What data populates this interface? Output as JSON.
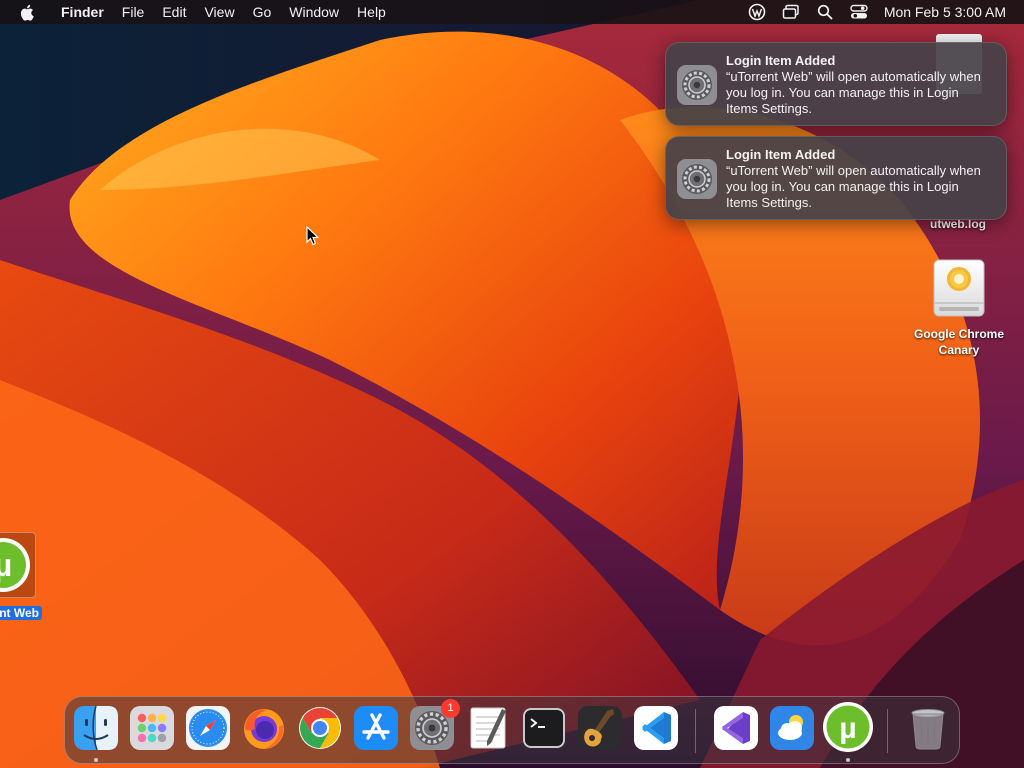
{
  "menubar": {
    "app_name": "Finder",
    "menus": [
      "File",
      "Edit",
      "View",
      "Go",
      "Window",
      "Help"
    ],
    "clock": "Mon Feb 5  3:00 AM"
  },
  "notifications": [
    {
      "title": "Login Item Added",
      "body": "“uTorrent Web” will open automatically when you log in. You can manage this in Login Items Settings.",
      "icon": "system-settings-icon"
    },
    {
      "title": "Login Item Added",
      "body": "“uTorrent Web” will open automatically when you log in. You can manage this in Login Items Settings.",
      "icon": "system-settings-icon"
    }
  ],
  "desktop": {
    "icons": [
      {
        "label": "utweb.log",
        "icon": "log-file-icon"
      },
      {
        "label": "Google Chrome Canary",
        "icon": "disk-image-icon"
      },
      {
        "label": "nt Web",
        "icon": "utorrent-icon",
        "selected": true
      }
    ]
  },
  "dock": {
    "items": [
      {
        "name": "Finder",
        "icon": "finder-icon",
        "running": true
      },
      {
        "name": "Launchpad",
        "icon": "launchpad-icon"
      },
      {
        "name": "Safari",
        "icon": "safari-icon"
      },
      {
        "name": "Firefox",
        "icon": "firefox-icon"
      },
      {
        "name": "Google Chrome",
        "icon": "chrome-icon"
      },
      {
        "name": "App Store",
        "icon": "app-store-icon"
      },
      {
        "name": "System Settings",
        "icon": "system-settings-icon",
        "badge": "1"
      },
      {
        "name": "TextEdit",
        "icon": "textedit-icon"
      },
      {
        "name": "Terminal",
        "icon": "terminal-icon"
      },
      {
        "name": "GarageBand",
        "icon": "garageband-icon"
      },
      {
        "name": "Visual Studio Code",
        "icon": "vscode-icon"
      },
      {
        "name": "Visual Studio",
        "icon": "visual-studio-icon"
      },
      {
        "name": "Weather",
        "icon": "weather-icon"
      },
      {
        "name": "uTorrent Web",
        "icon": "utorrent-icon",
        "running": true
      },
      {
        "name": "Trash",
        "icon": "trash-icon"
      }
    ]
  },
  "colors": {
    "wallpaper_orange": "#f26a12",
    "wallpaper_yellow": "#ffb020",
    "selection_blue": "#1f6fe0",
    "badge_red": "#ff3b30"
  }
}
